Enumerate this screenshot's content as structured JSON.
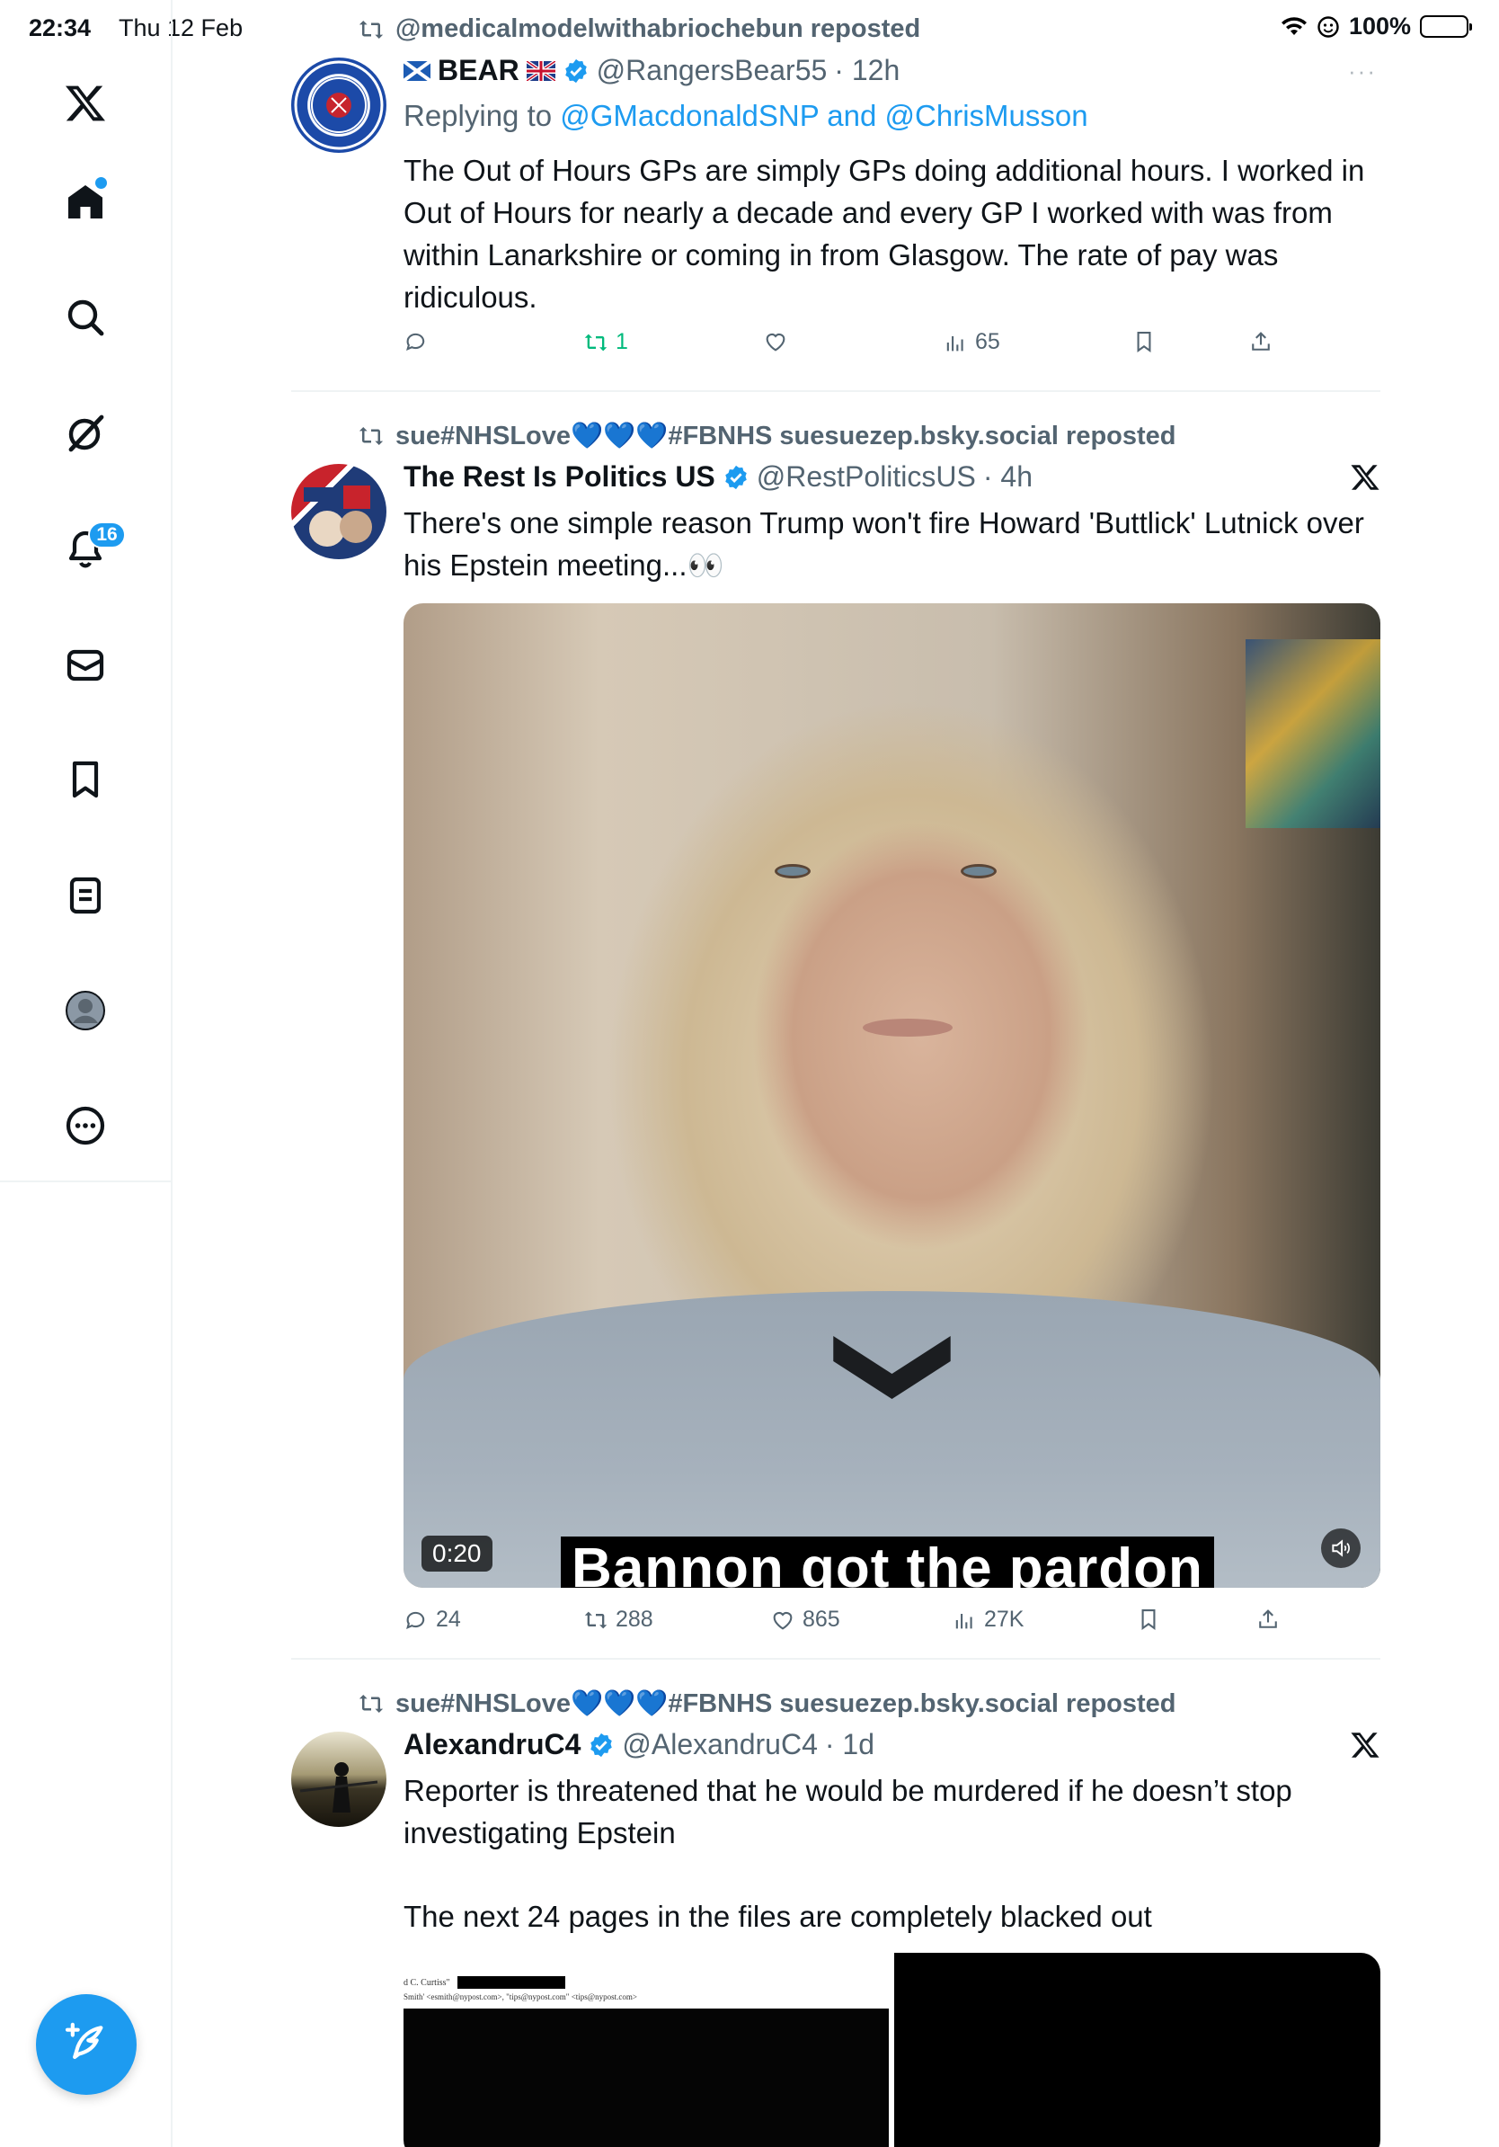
{
  "status": {
    "time": "22:34",
    "date": "Thu 12 Feb",
    "battery": "100%"
  },
  "sidebar": {
    "notifications_badge": "16"
  },
  "tweets": [
    {
      "repost_by": "@medicalmodelwithabriochebun reposted",
      "name": "BEAR",
      "handle": "@RangersBear55",
      "time": "· 12h",
      "replying_prefix": "Replying to ",
      "replying_to": "@GMacdonaldSNP and @ChrisMusson",
      "text": "The Out of Hours GPs are simply GPs doing additional hours. I worked in Out of Hours for nearly a decade and every GP I worked with was from within Lanarkshire or coming in from Glasgow. The rate of pay was ridiculous.",
      "reposts": "1",
      "views": "65",
      "more": "···"
    },
    {
      "repost_by": "sue#NHSLove💙💙💙#FBNHS suesuezep.bsky.social reposted",
      "name": "The Rest Is Politics US",
      "handle": "@RestPoliticsUS",
      "time": "· 4h",
      "text": "There's one simple reason Trump won't fire Howard 'Buttlick' Lutnick over his Epstein meeting...👀",
      "video_caption": "Bannon got the pardon",
      "duration": "0:20",
      "replies": "24",
      "reposts": "288",
      "likes": "865",
      "views": "27K"
    },
    {
      "repost_by": "sue#NHSLove💙💙💙#FBNHS suesuezep.bsky.social reposted",
      "name": "AlexandruC4",
      "handle": "@AlexandruC4",
      "time": "· 1d",
      "text_line1": "Reporter is threatened that he would be murdered if he doesn’t stop investigating Epstein",
      "text_line2": "The next 24 pages in the files are completely blacked out",
      "doc_line1": "d C. Curtiss\"",
      "doc_line2": "Smith' <esmith@nypost.com>, \"tips@nypost.com\" <tips@nypost.com>"
    }
  ],
  "colors": {
    "accent": "#1d9bf0",
    "secondary_text": "#536471",
    "retweet_green": "#00ba7c",
    "divider": "#eff3f4"
  },
  "icons": [
    "x-logo-icon",
    "home-icon",
    "search-icon",
    "grok-icon",
    "bell-icon",
    "mail-icon",
    "bookmark-icon",
    "list-icon",
    "profile-icon",
    "more-icon",
    "compose-icon",
    "reply-icon",
    "repost-icon",
    "like-icon",
    "views-icon",
    "share-icon",
    "verified-icon"
  ]
}
